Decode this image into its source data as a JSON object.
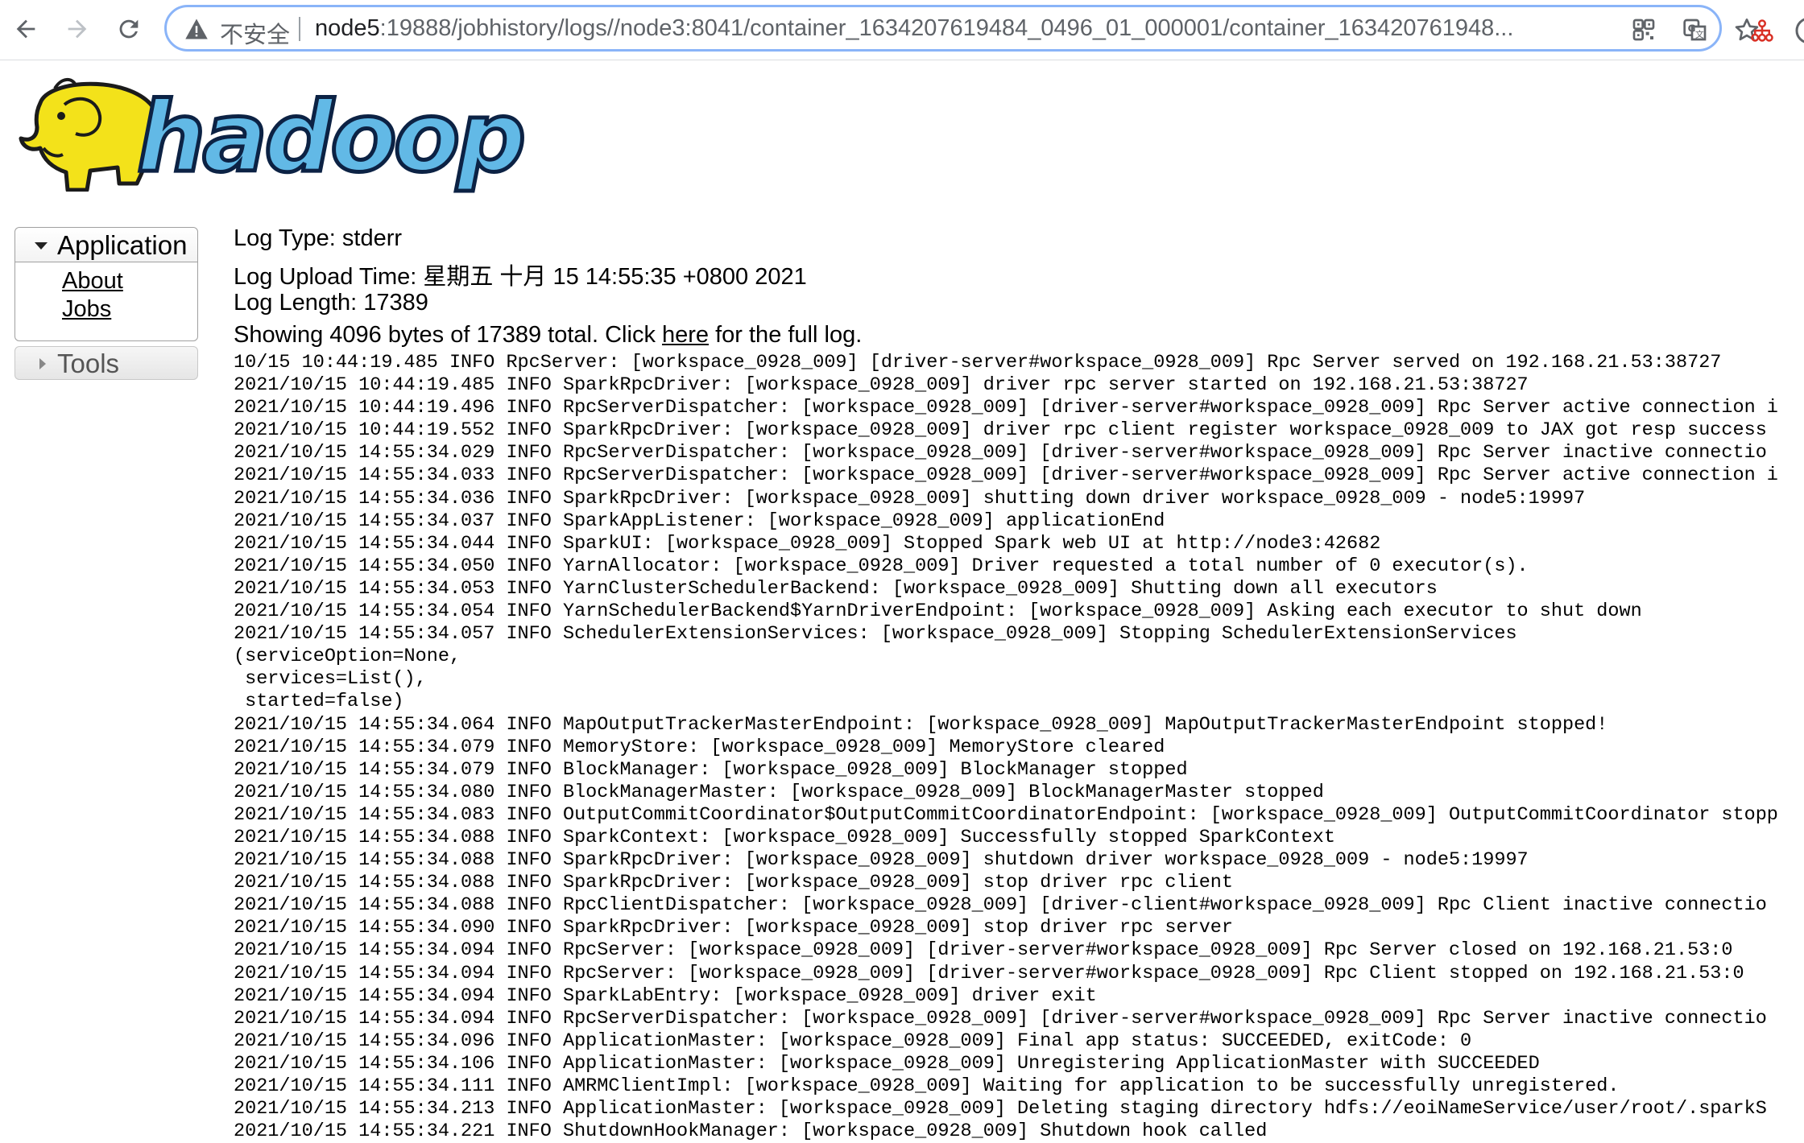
{
  "browser": {
    "security_label": "不安全",
    "url_host": "node5",
    "url_rest": ":19888/jobhistory/logs//node3:8041/container_1634207619484_0496_01_000001/container_163420761948...",
    "icons": [
      "back-arrow-icon",
      "forward-arrow-icon",
      "reload-icon",
      "warning-icon",
      "qr-code-icon",
      "translate-icon",
      "star-icon",
      "extension-icon"
    ]
  },
  "logo": {
    "text": "hadoop"
  },
  "sidebar": {
    "application_label": "Application",
    "links": [
      {
        "label": "About"
      },
      {
        "label": "Jobs"
      }
    ],
    "tools_label": "Tools"
  },
  "log_meta": {
    "log_type": "Log Type: stderr",
    "upload_time": "Log Upload Time: 星期五 十月 15 14:55:35 +0800 2021",
    "log_length": "Log Length: 17389",
    "showing_prefix": "Showing 4096 bytes of 17389 total. Click ",
    "here_link": "here",
    "showing_suffix": " for the full log."
  },
  "log_lines": [
    "10/15 10:44:19.485 INFO RpcServer: [workspace_0928_009] [driver-server#workspace_0928_009] Rpc Server served on 192.168.21.53:38727",
    "2021/10/15 10:44:19.485 INFO SparkRpcDriver: [workspace_0928_009] driver rpc server started on 192.168.21.53:38727",
    "2021/10/15 10:44:19.496 INFO RpcServerDispatcher: [workspace_0928_009] [driver-server#workspace_0928_009] Rpc Server active connection i",
    "2021/10/15 10:44:19.552 INFO SparkRpcDriver: [workspace_0928_009] driver rpc client register workspace_0928_009 to JAX got resp success",
    "2021/10/15 14:55:34.029 INFO RpcServerDispatcher: [workspace_0928_009] [driver-server#workspace_0928_009] Rpc Server inactive connectio",
    "2021/10/15 14:55:34.033 INFO RpcServerDispatcher: [workspace_0928_009] [driver-server#workspace_0928_009] Rpc Server active connection i",
    "2021/10/15 14:55:34.036 INFO SparkRpcDriver: [workspace_0928_009] shutting down driver workspace_0928_009 - node5:19997",
    "2021/10/15 14:55:34.037 INFO SparkAppListener: [workspace_0928_009] applicationEnd",
    "2021/10/15 14:55:34.044 INFO SparkUI: [workspace_0928_009] Stopped Spark web UI at http://node3:42682",
    "2021/10/15 14:55:34.050 INFO YarnAllocator: [workspace_0928_009] Driver requested a total number of 0 executor(s).",
    "2021/10/15 14:55:34.053 INFO YarnClusterSchedulerBackend: [workspace_0928_009] Shutting down all executors",
    "2021/10/15 14:55:34.054 INFO YarnSchedulerBackend$YarnDriverEndpoint: [workspace_0928_009] Asking each executor to shut down",
    "2021/10/15 14:55:34.057 INFO SchedulerExtensionServices: [workspace_0928_009] Stopping SchedulerExtensionServices",
    "(serviceOption=None,",
    " services=List(),",
    " started=false)",
    "2021/10/15 14:55:34.064 INFO MapOutputTrackerMasterEndpoint: [workspace_0928_009] MapOutputTrackerMasterEndpoint stopped!",
    "2021/10/15 14:55:34.079 INFO MemoryStore: [workspace_0928_009] MemoryStore cleared",
    "2021/10/15 14:55:34.079 INFO BlockManager: [workspace_0928_009] BlockManager stopped",
    "2021/10/15 14:55:34.080 INFO BlockManagerMaster: [workspace_0928_009] BlockManagerMaster stopped",
    "2021/10/15 14:55:34.083 INFO OutputCommitCoordinator$OutputCommitCoordinatorEndpoint: [workspace_0928_009] OutputCommitCoordinator stopp",
    "2021/10/15 14:55:34.088 INFO SparkContext: [workspace_0928_009] Successfully stopped SparkContext",
    "2021/10/15 14:55:34.088 INFO SparkRpcDriver: [workspace_0928_009] shutdown driver workspace_0928_009 - node5:19997",
    "2021/10/15 14:55:34.088 INFO SparkRpcDriver: [workspace_0928_009] stop driver rpc client",
    "2021/10/15 14:55:34.088 INFO RpcClientDispatcher: [workspace_0928_009] [driver-client#workspace_0928_009] Rpc Client inactive connectio",
    "2021/10/15 14:55:34.090 INFO SparkRpcDriver: [workspace_0928_009] stop driver rpc server",
    "2021/10/15 14:55:34.094 INFO RpcServer: [workspace_0928_009] [driver-server#workspace_0928_009] Rpc Server closed on 192.168.21.53:0",
    "2021/10/15 14:55:34.094 INFO RpcServer: [workspace_0928_009] [driver-server#workspace_0928_009] Rpc Client stopped on 192.168.21.53:0",
    "2021/10/15 14:55:34.094 INFO SparkLabEntry: [workspace_0928_009] driver exit",
    "2021/10/15 14:55:34.094 INFO RpcServerDispatcher: [workspace_0928_009] [driver-server#workspace_0928_009] Rpc Server inactive connectio",
    "2021/10/15 14:55:34.096 INFO ApplicationMaster: [workspace_0928_009] Final app status: SUCCEEDED, exitCode: 0",
    "2021/10/15 14:55:34.106 INFO ApplicationMaster: [workspace_0928_009] Unregistering ApplicationMaster with SUCCEEDED",
    "2021/10/15 14:55:34.111 INFO AMRMClientImpl: [workspace_0928_009] Waiting for application to be successfully unregistered.",
    "2021/10/15 14:55:34.213 INFO ApplicationMaster: [workspace_0928_009] Deleting staging directory hdfs://eoiNameService/user/root/.sparkS",
    "2021/10/15 14:55:34.221 INFO ShutdownHookManager: [workspace_0928_009] Shutdown hook called"
  ]
}
